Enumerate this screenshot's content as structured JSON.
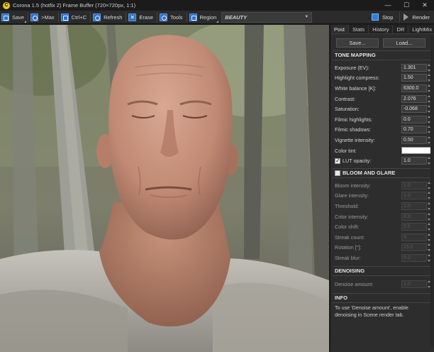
{
  "window": {
    "title": "Corona 1.5 (hotfix 2) Frame Buffer (720×720px, 1:1)",
    "app_icon": "C",
    "controls": [
      "—",
      "☐",
      "✕"
    ]
  },
  "toolbar": {
    "save": "Save",
    "max": ">Max",
    "copy": "Ctrl+C",
    "refresh": "Refresh",
    "erase": "Erase",
    "tools": "Tools",
    "region": "Region",
    "pass": "BEAUTY",
    "stop": "Stop",
    "render": "Render"
  },
  "panel": {
    "tabs": [
      "Post",
      "Stats",
      "History",
      "DR",
      "LightMix"
    ],
    "active_tab": "Post",
    "save_button": "Save...",
    "load_button": "Load...",
    "tone_mapping": {
      "header": "TONE MAPPING",
      "rows": [
        {
          "label": "Exposure (EV):",
          "value": "1.301"
        },
        {
          "label": "Highlight compress:",
          "value": "1.50"
        },
        {
          "label": "White balance [K]:",
          "value": "6300.0"
        },
        {
          "label": "Contrast:",
          "value": "2.076"
        },
        {
          "label": "Saturation:",
          "value": "-0.068"
        },
        {
          "label": "Filmic highlights:",
          "value": "0.0"
        },
        {
          "label": "Filmic shadows:",
          "value": "0.70"
        },
        {
          "label": "Vignette intensity:",
          "value": "0.50"
        }
      ],
      "color_tint_label": "Color tint:",
      "color_tint": "#ffffff",
      "lut_label": "LUT opacity:",
      "lut_value": "1.0",
      "lut_checked": true
    },
    "bloom_glare": {
      "header": "BLOOM AND GLARE",
      "checked": false,
      "rows": [
        {
          "label": "Bloom intensity:",
          "value": "1.0"
        },
        {
          "label": "Glare intensity:",
          "value": "1.0"
        },
        {
          "label": "Threshold:",
          "value": "1.0"
        },
        {
          "label": "Color intensity:",
          "value": "0.3"
        },
        {
          "label": "Color shift:",
          "value": "0.5"
        },
        {
          "label": "Streak count:",
          "value": "3"
        },
        {
          "label": "Rotation [°]:",
          "value": "15.0"
        },
        {
          "label": "Streak blur:",
          "value": "0.2"
        }
      ]
    },
    "denoising": {
      "header": "DENOISING",
      "row": {
        "label": "Denoise amount:",
        "value": "1.0"
      }
    },
    "info": {
      "header": "INFO",
      "text": "To use 'Denoise amount', enable denoising in Scene render tab."
    }
  },
  "colors": {
    "accent": "#2e6fc7",
    "panel_bg": "#2d2d2d",
    "toolbar_bg": "#2b2b2b"
  }
}
